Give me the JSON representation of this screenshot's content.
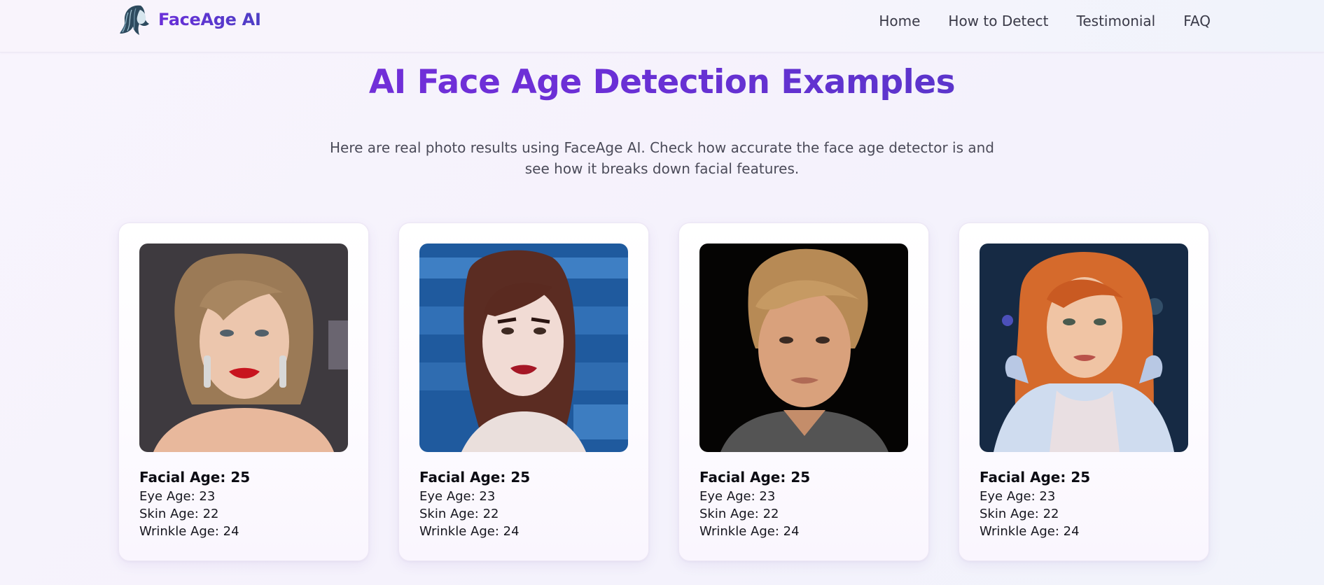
{
  "header": {
    "brand": "FaceAge AI",
    "nav": [
      "Home",
      "How to Detect",
      "Testimonial",
      "FAQ"
    ]
  },
  "section": {
    "title": "AI Face Age Detection Examples",
    "subtitle": "Here are real photo results using FaceAge AI. Check how accurate the face age detector is and see how it breaks down facial features."
  },
  "examples": [
    {
      "facial": "Facial Age: 25",
      "eye": "Eye Age: 23",
      "skin": "Skin Age: 22",
      "wrinkle": "Wrinkle Age: 24"
    },
    {
      "facial": "Facial Age: 25",
      "eye": "Eye Age: 23",
      "skin": "Skin Age: 22",
      "wrinkle": "Wrinkle Age: 24"
    },
    {
      "facial": "Facial Age: 25",
      "eye": "Eye Age: 23",
      "skin": "Skin Age: 22",
      "wrinkle": "Wrinkle Age: 24"
    },
    {
      "facial": "Facial Age: 25",
      "eye": "Eye Age: 23",
      "skin": "Skin Age: 22",
      "wrinkle": "Wrinkle Age: 24"
    }
  ],
  "colors": {
    "accent": "#6b2fd9",
    "accent_dark": "#4b3bc0",
    "text_muted": "#4b4b59"
  },
  "icons": {
    "logo": "woman-profile-logo-icon"
  }
}
